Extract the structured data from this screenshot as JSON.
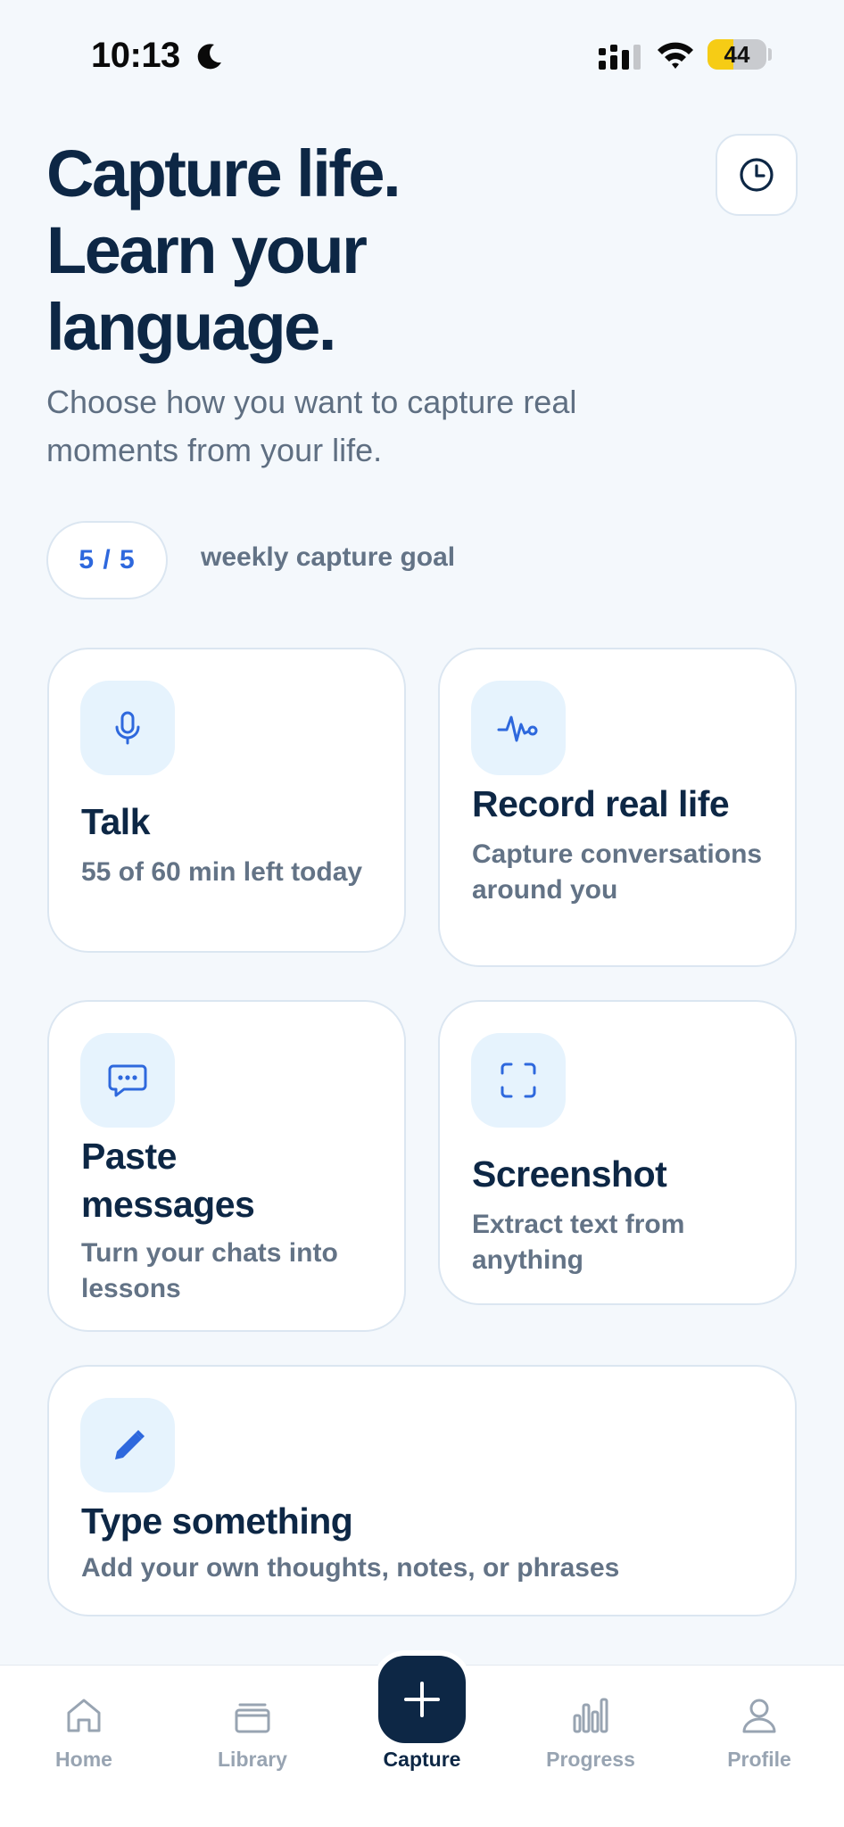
{
  "status_bar": {
    "time": "10:13",
    "battery_level": "44",
    "battery_fraction": 0.44
  },
  "header": {
    "headline_lines": [
      "Capture life.",
      "Learn your",
      "language."
    ],
    "subtitle": "Choose how you want to capture real moments from your life.",
    "history_icon": "clock-icon"
  },
  "goal": {
    "progress": "5 / 5",
    "label": "weekly capture goal"
  },
  "cards": {
    "talk": {
      "icon": "microphone-icon",
      "title": "Talk",
      "description": "55 of 60 min left today"
    },
    "record": {
      "icon": "waveform-icon",
      "title": "Record real life",
      "description": "Capture conversations around you"
    },
    "paste": {
      "icon": "chat-bubble-icon",
      "title": "Paste messages",
      "description": "Turn your chats into lessons"
    },
    "screenshot": {
      "icon": "scan-frame-icon",
      "title": "Screenshot",
      "description": "Extract text from anything"
    },
    "type": {
      "icon": "pencil-icon",
      "title": "Type something",
      "description": "Add your own thoughts, notes, or phrases"
    }
  },
  "nav": {
    "items": [
      {
        "label": "Home",
        "icon": "home-icon"
      },
      {
        "label": "Library",
        "icon": "library-icon"
      },
      {
        "label": "Capture",
        "icon": "plus-icon",
        "active": true
      },
      {
        "label": "Progress",
        "icon": "bar-chart-icon"
      },
      {
        "label": "Profile",
        "icon": "person-icon"
      }
    ]
  },
  "colors": {
    "background": "#f4f8fc",
    "primary_navy": "#0d2745",
    "accent_blue": "#2e68dd",
    "icon_tile": "#e6f3fd",
    "muted_text": "#637386",
    "nav_inactive": "#98a4b2",
    "battery_yellow": "#f6cc15"
  }
}
